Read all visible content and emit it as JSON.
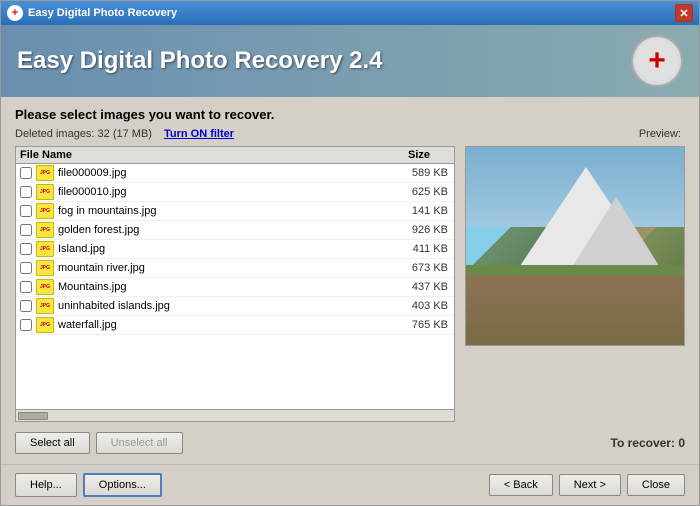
{
  "window": {
    "title": "Easy Digital Photo Recovery",
    "close_button": "✕"
  },
  "header": {
    "title": "Easy Digital Photo Recovery 2.4",
    "logo": "+"
  },
  "main": {
    "instruction": "Please select images you want to recover.",
    "deleted_info": "Deleted images: 32 (17 MB)",
    "filter_link": "Turn ON filter",
    "preview_label": "Preview:",
    "file_list": {
      "col_filename": "File Name",
      "col_size": "Size",
      "files": [
        {
          "name": "file000009.jpg",
          "size": "589 KB"
        },
        {
          "name": "file000010.jpg",
          "size": "625 KB"
        },
        {
          "name": "fog in mountains.jpg",
          "size": "141 KB"
        },
        {
          "name": "golden forest.jpg",
          "size": "926 KB"
        },
        {
          "name": "Island.jpg",
          "size": "411 KB"
        },
        {
          "name": "mountain river.jpg",
          "size": "673 KB"
        },
        {
          "name": "Mountains.jpg",
          "size": "437 KB"
        },
        {
          "name": "uninhabited islands.jpg",
          "size": "403 KB"
        },
        {
          "name": "waterfall.jpg",
          "size": "765 KB"
        }
      ]
    },
    "select_all": "Select all",
    "unselect_all": "Unselect all",
    "to_recover_label": "To recover:",
    "to_recover_value": "0"
  },
  "footer": {
    "help": "Help...",
    "options": "Options...",
    "back": "< Back",
    "next": "Next >",
    "close": "Close"
  }
}
